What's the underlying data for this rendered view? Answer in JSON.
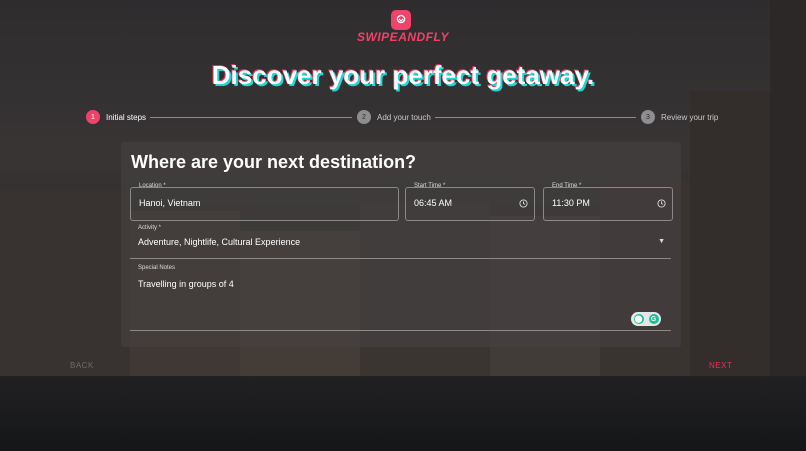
{
  "brand": {
    "name": "SWIPEANDFLY",
    "accent": "#f0426a",
    "logo_icon": "heart-pin-icon"
  },
  "hero": {
    "title": "Discover your perfect getaway."
  },
  "stepper": {
    "steps": [
      {
        "num": "1",
        "label": "Initial steps",
        "state": "active"
      },
      {
        "num": "2",
        "label": "Add your touch",
        "state": "idle"
      },
      {
        "num": "3",
        "label": "Review your trip",
        "state": "idle"
      }
    ]
  },
  "form": {
    "title": "Where are your next destination?",
    "location": {
      "label": "Location *",
      "value": "Hanoi, Vietnam"
    },
    "start_time": {
      "label": "Start Time *",
      "value": "06:45 AM",
      "icon": "clock-icon"
    },
    "end_time": {
      "label": "End Time *",
      "value": "11:30 PM",
      "icon": "clock-icon"
    },
    "activity": {
      "label": "Activity *",
      "value": "Adventure, Nightlife, Cultural Experience",
      "icon": "caret-down-icon"
    },
    "notes": {
      "label": "Special Notes",
      "value": "Travelling in groups of 4"
    }
  },
  "nav": {
    "back": "BACK",
    "next": "NEXT"
  }
}
